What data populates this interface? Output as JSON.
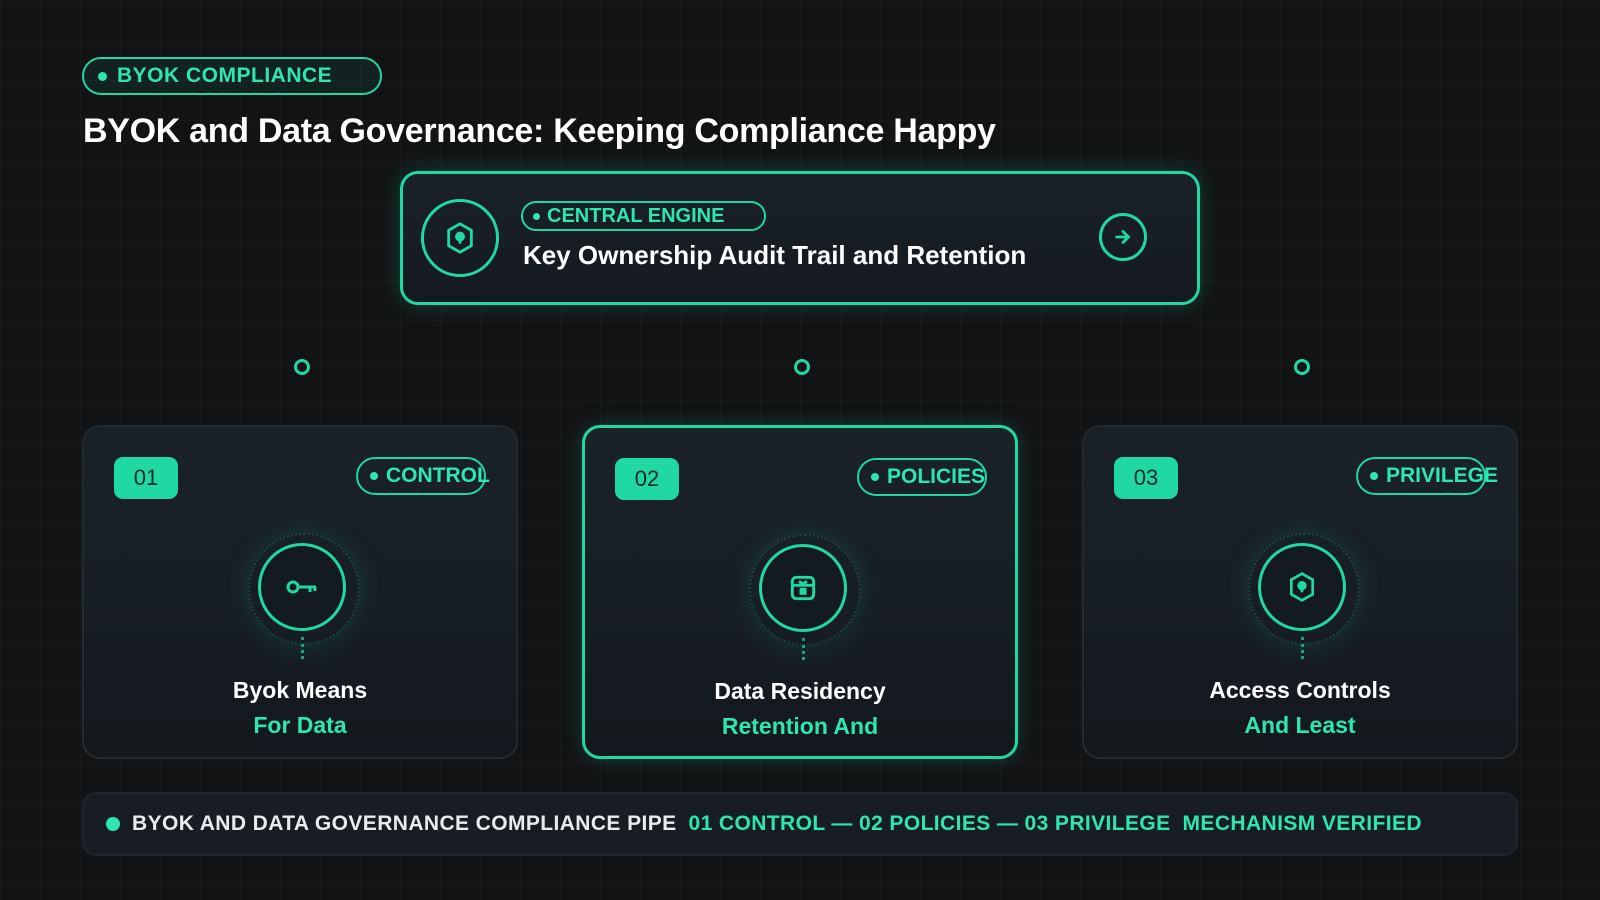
{
  "header": {
    "badge_label": "BYOK COMPLIANCE",
    "title": "BYOK and Data Governance: Keeping Compliance Happy"
  },
  "engine": {
    "tag": "CENTRAL ENGINE",
    "name": "Key Ownership Audit Trail and Retention",
    "icon": "shield-icon",
    "action_icon": "arrow-right-icon"
  },
  "cards": [
    {
      "number": "01",
      "tag": "CONTROL",
      "title": "Byok Means",
      "subtitle": "For Data",
      "icon": "key-icon"
    },
    {
      "number": "02",
      "tag": "POLICIES",
      "title": "Data Residency",
      "subtitle": "Retention And",
      "icon": "vault-icon"
    },
    {
      "number": "03",
      "tag": "PRIVILEGE",
      "title": "Access Controls",
      "subtitle": "And Least",
      "icon": "shield-lock-icon"
    }
  ],
  "footer": {
    "left": "BYOK AND DATA GOVERNANCE COMPLIANCE PIPE",
    "middle": "01 CONTROL — 02 POLICIES — 03 PRIVILEGE",
    "right": "MECHANISM VERIFIED"
  },
  "colors": {
    "accent": "#1fd8a4",
    "background": "#121315",
    "card": "#1a2229"
  }
}
